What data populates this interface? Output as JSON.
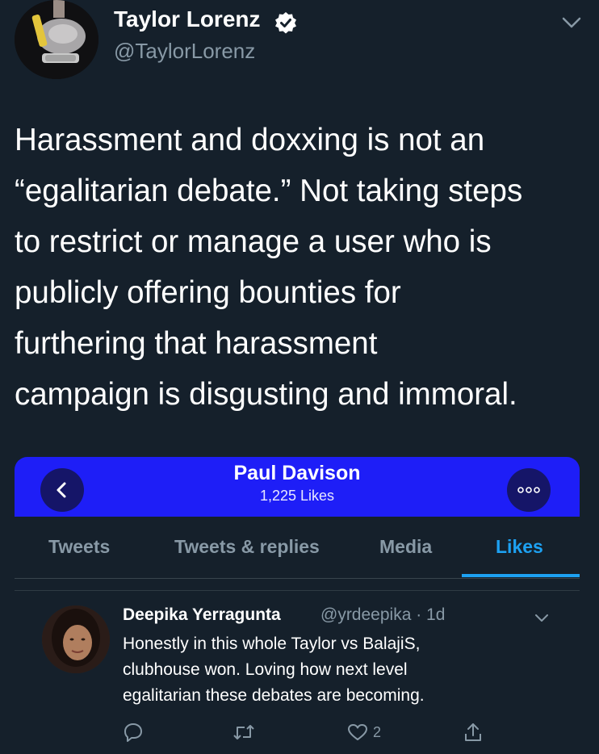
{
  "tweet": {
    "author_name": "Taylor Lorenz",
    "author_handle": "@TaylorLorenz",
    "verified": true,
    "body_lines": [
      "Harassment and doxxing is not an",
      "“egalitarian debate.” Not taking steps",
      "to restrict or manage a user who is",
      "publicly offering bounties for",
      "furthering that harassment",
      "campaign is disgusting and immoral."
    ]
  },
  "embed": {
    "profile": {
      "name": "Paul Davison",
      "likes": "1,225 Likes"
    },
    "tabs": [
      {
        "label": "Tweets",
        "active": false
      },
      {
        "label": "Tweets & replies",
        "active": false
      },
      {
        "label": "Media",
        "active": false
      },
      {
        "label": "Likes",
        "active": true
      }
    ],
    "reply": {
      "name": "Deepika Yerragunta",
      "meta": "@yrdeepika · 1d",
      "text_lines": [
        "Honestly in this whole Taylor vs BalajiS,",
        "clubhouse won. Loving how next level",
        "egalitarian these debates are becoming."
      ],
      "like_count": "2"
    }
  },
  "colors": {
    "background": "#15202b",
    "profile_bar": "#1e1ef7",
    "accent": "#1da1f2",
    "secondary_text": "#8899a6"
  },
  "icons": {
    "verified": "verified-badge-icon",
    "chevron": "chevron-down-icon",
    "back": "back-arrow-icon",
    "more": "more-options-icon",
    "reply": "reply-icon",
    "retweet": "retweet-icon",
    "like": "heart-icon",
    "share": "share-icon"
  }
}
